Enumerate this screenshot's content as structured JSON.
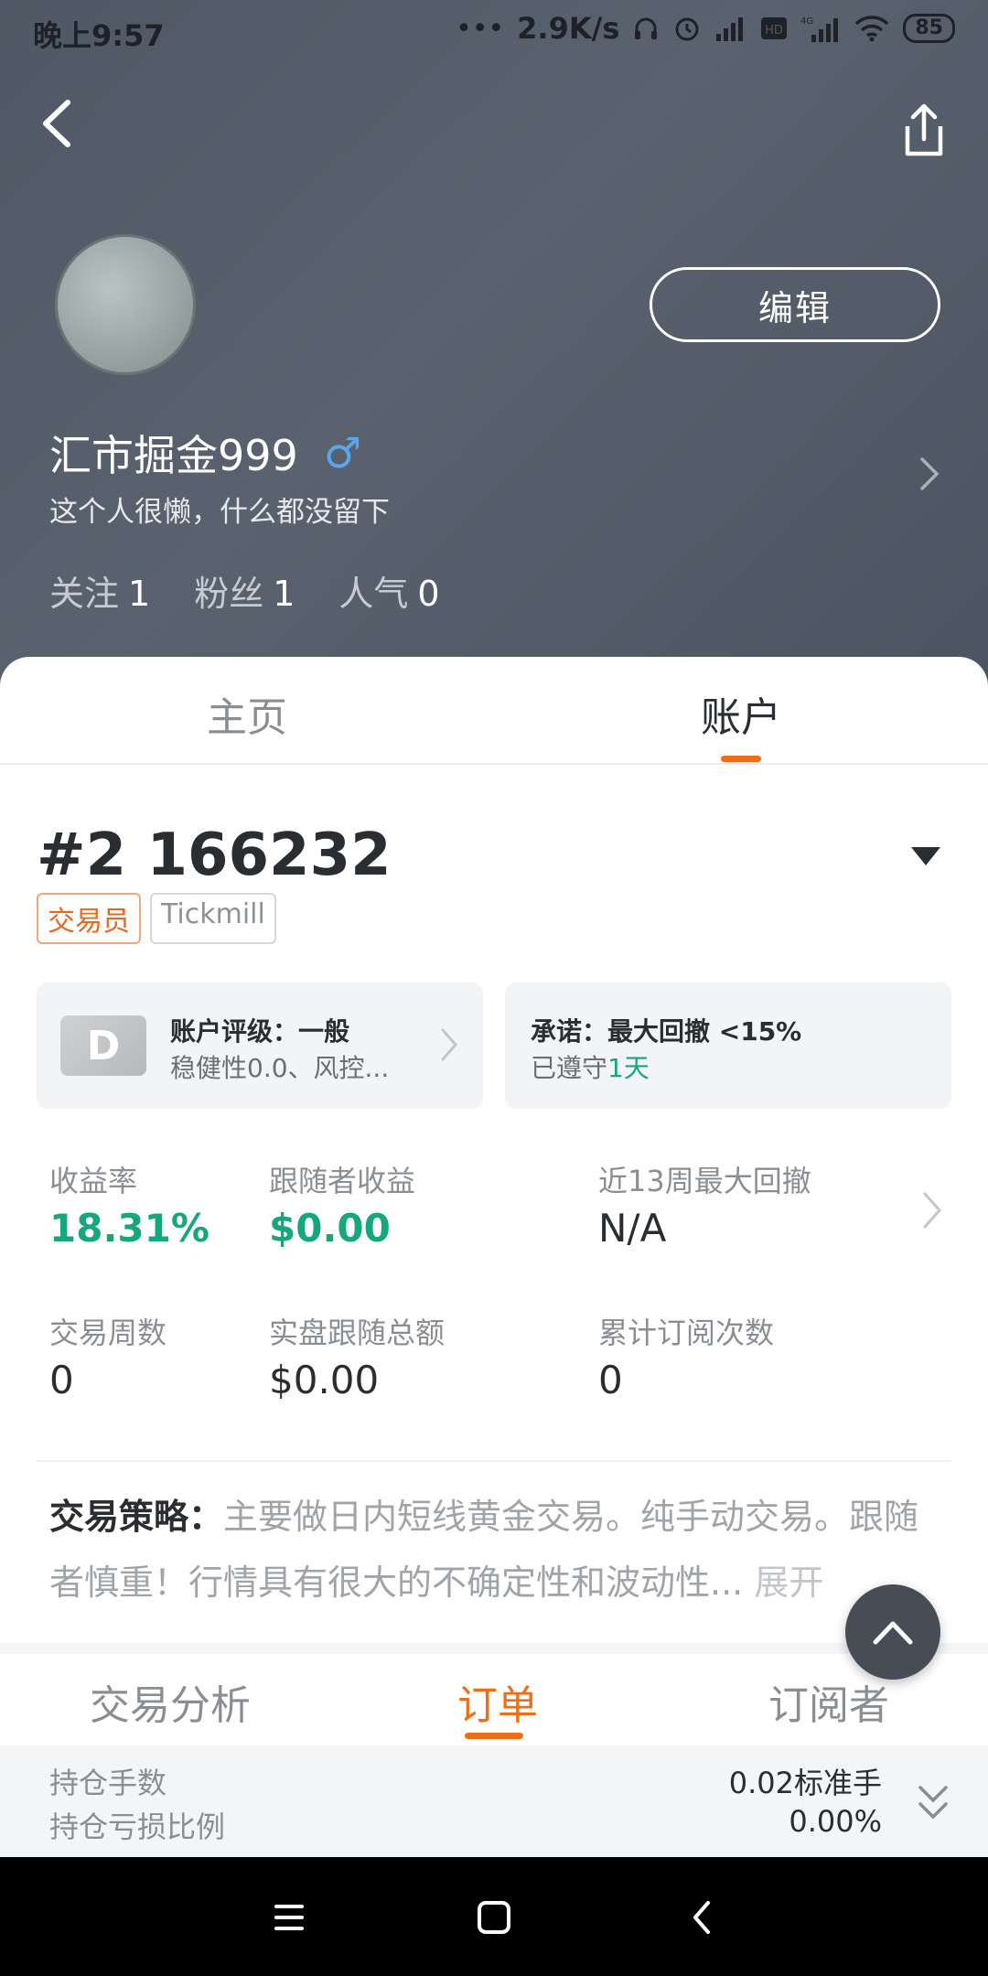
{
  "status_bar": {
    "time": "晚上9:57",
    "speed": "2.9K/s",
    "battery": "85"
  },
  "profile": {
    "username": "汇市掘金999",
    "gender_symbol": "♂",
    "bio": "这个人很懒，什么都没留下",
    "edit_label": "编辑",
    "stats": [
      {
        "label": "关注",
        "value": "1"
      },
      {
        "label": "粉丝",
        "value": "1"
      },
      {
        "label": "人气",
        "value": "0"
      }
    ]
  },
  "top_tabs": [
    {
      "label": "主页",
      "active": false
    },
    {
      "label": "账户",
      "active": true
    }
  ],
  "account": {
    "id": "#2 166232",
    "badges": [
      "交易员",
      "Tickmill"
    ],
    "rating": {
      "grade": "D",
      "title": "账户评级：一般",
      "subtitle": "稳健性0.0、风控..."
    },
    "promise": {
      "title": "承诺：最大回撤 <15%",
      "subtitle_prefix": "已遵守",
      "subtitle_value": "1天"
    }
  },
  "metrics": {
    "return_rate": {
      "label": "收益率",
      "value": "18.31%"
    },
    "follower_profit": {
      "label": "跟随者收益",
      "value": "$0.00"
    },
    "max_drawdown": {
      "label": "近13周最大回撤",
      "value": "N/A"
    },
    "trading_weeks": {
      "label": "交易周数",
      "value": "0"
    },
    "live_follow_total": {
      "label": "实盘跟随总额",
      "value": "$0.00"
    },
    "total_subscriptions": {
      "label": "累计订阅次数",
      "value": "0"
    }
  },
  "strategy": {
    "label": "交易策略：",
    "text": "主要做日内短线黄金交易。纯手动交易。跟随者慎重！行情具有很大的不确定性和波动性...",
    "expand": "展开"
  },
  "bottom_tabs": [
    {
      "label": "交易分析",
      "active": false
    },
    {
      "label": "订单",
      "active": true
    },
    {
      "label": "订阅者",
      "active": false
    }
  ],
  "summary": {
    "position_lots_label": "持仓手数",
    "position_lots_value": "0.02标准手",
    "position_pl_label": "持仓亏损比例",
    "position_pl_value": "0.00%"
  },
  "colors": {
    "accent": "#ee6d17",
    "positive": "#16a77a",
    "header_bg": "#545d69",
    "gender": "#5aa6ee"
  }
}
